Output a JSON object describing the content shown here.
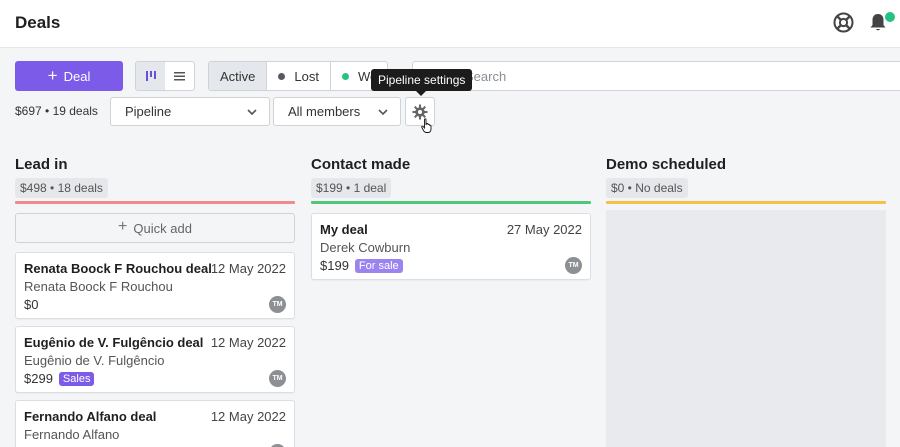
{
  "header": {
    "title": "Deals",
    "help_icon": "lifebuoy-icon",
    "notifications_icon": "bell-icon"
  },
  "toolbar": {
    "add_deal_label": "Deal",
    "views": [
      {
        "icon": "kanban-icon",
        "active": true
      },
      {
        "icon": "list-icon",
        "active": false
      }
    ],
    "status_tabs": [
      {
        "label": "Active",
        "active": true
      },
      {
        "label": "Lost",
        "dot_color": "#555a60"
      },
      {
        "label": "Won",
        "dot_color": "#25c281"
      }
    ],
    "search_placeholder": "Search",
    "tooltip": "Pipeline settings",
    "summary": "$697 • 19 deals",
    "pipeline_select": "Pipeline",
    "members_select": "All members",
    "settings_icon": "gear-icon"
  },
  "colors": {
    "accent": "#7c5be8",
    "lead_in": "#ef8a8f",
    "contact_made": "#4fc87a",
    "demo_scheduled": "#f6c14a"
  },
  "columns": [
    {
      "title": "Lead in",
      "meta": "$498 • 18 deals",
      "quick_add": "Quick add",
      "cards": [
        {
          "title": "Renata Boock F Rouchou deal",
          "date": "12 May 2022",
          "person": "Renata Boock F Rouchou",
          "amount": "$0",
          "tag": "",
          "avatar": "TM"
        },
        {
          "title": "Eugênio de V. Fulgêncio deal",
          "date": "12 May 2022",
          "person": "Eugênio de V. Fulgêncio",
          "amount": "$299",
          "tag": "Sales",
          "avatar": "TM"
        },
        {
          "title": "Fernando Alfano deal",
          "date": "12 May 2022",
          "person": "Fernando Alfano",
          "amount": "",
          "tag": "",
          "avatar": "TM"
        }
      ]
    },
    {
      "title": "Contact made",
      "meta": "$199 • 1 deal",
      "cards": [
        {
          "title": "My deal",
          "date": "27 May 2022",
          "person": "Derek Cowburn",
          "amount": "$199",
          "tag": "For sale",
          "avatar": "TM"
        }
      ]
    },
    {
      "title": "Demo scheduled",
      "meta": "$0 • No deals",
      "cards": []
    }
  ]
}
